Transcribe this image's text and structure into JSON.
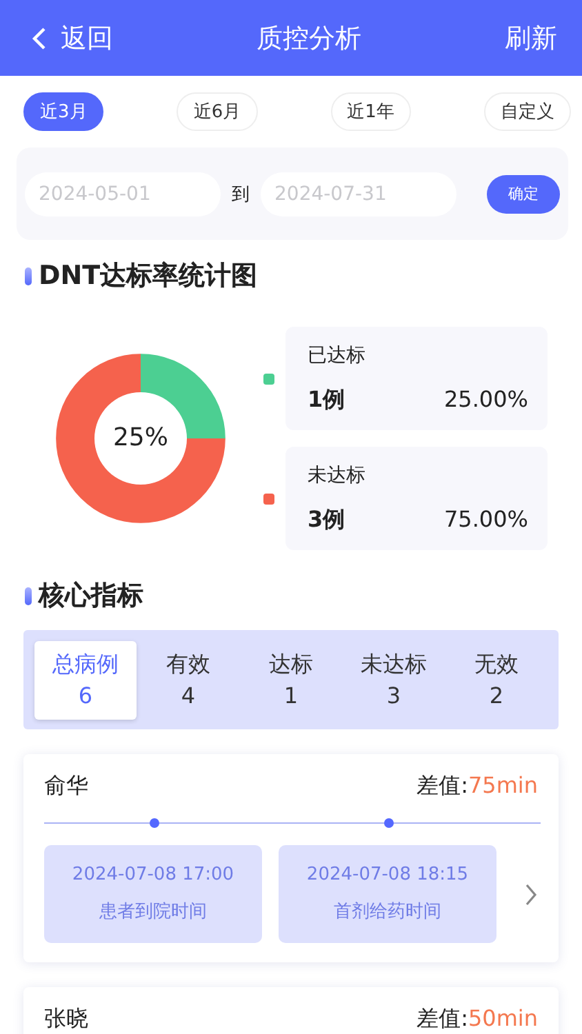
{
  "header": {
    "back": "返回",
    "title": "质控分析",
    "action": "刷新"
  },
  "ranges": [
    {
      "label": "近3月",
      "selected": true
    },
    {
      "label": "近6月",
      "selected": false
    },
    {
      "label": "近1年",
      "selected": false
    },
    {
      "label": "自定义",
      "selected": false
    }
  ],
  "date_filter": {
    "start_placeholder": "2024-05-01",
    "separator": "到",
    "end_placeholder": "2024-07-31",
    "confirm": "确定"
  },
  "dnt_section": {
    "title": "DNT达标率统计图",
    "center_label": "25%",
    "chart_data": {
      "type": "donut",
      "categories": [
        "已达标",
        "未达标"
      ],
      "series": [
        {
          "values": [
            25,
            75
          ]
        }
      ]
    },
    "legend": [
      {
        "count": "1例",
        "percent": "25.00%",
        "color": "#4ccf92"
      },
      {
        "count": "3例",
        "percent": "75.00%",
        "color": "#f5624d"
      }
    ]
  },
  "core_section": {
    "title": "核心指标",
    "stats": [
      {
        "label": "总病例",
        "value": "6",
        "selected": true
      },
      {
        "label": "有效",
        "value": "4",
        "selected": false
      },
      {
        "label": "达标",
        "value": "1",
        "selected": false
      },
      {
        "label": "未达标",
        "value": "3",
        "selected": false
      },
      {
        "label": "无效",
        "value": "2",
        "selected": false
      }
    ]
  },
  "cases": [
    {
      "name": "俞华",
      "diff_label": "差值:",
      "diff_value": "75min",
      "events": [
        {
          "time": "2024-07-08 17:00",
          "label": "患者到院时间"
        },
        {
          "time": "2024-07-08 18:15",
          "label": "首剂给药时间"
        }
      ]
    },
    {
      "name": "张晓",
      "diff_label": "差值:",
      "diff_value": "50min"
    }
  ]
}
